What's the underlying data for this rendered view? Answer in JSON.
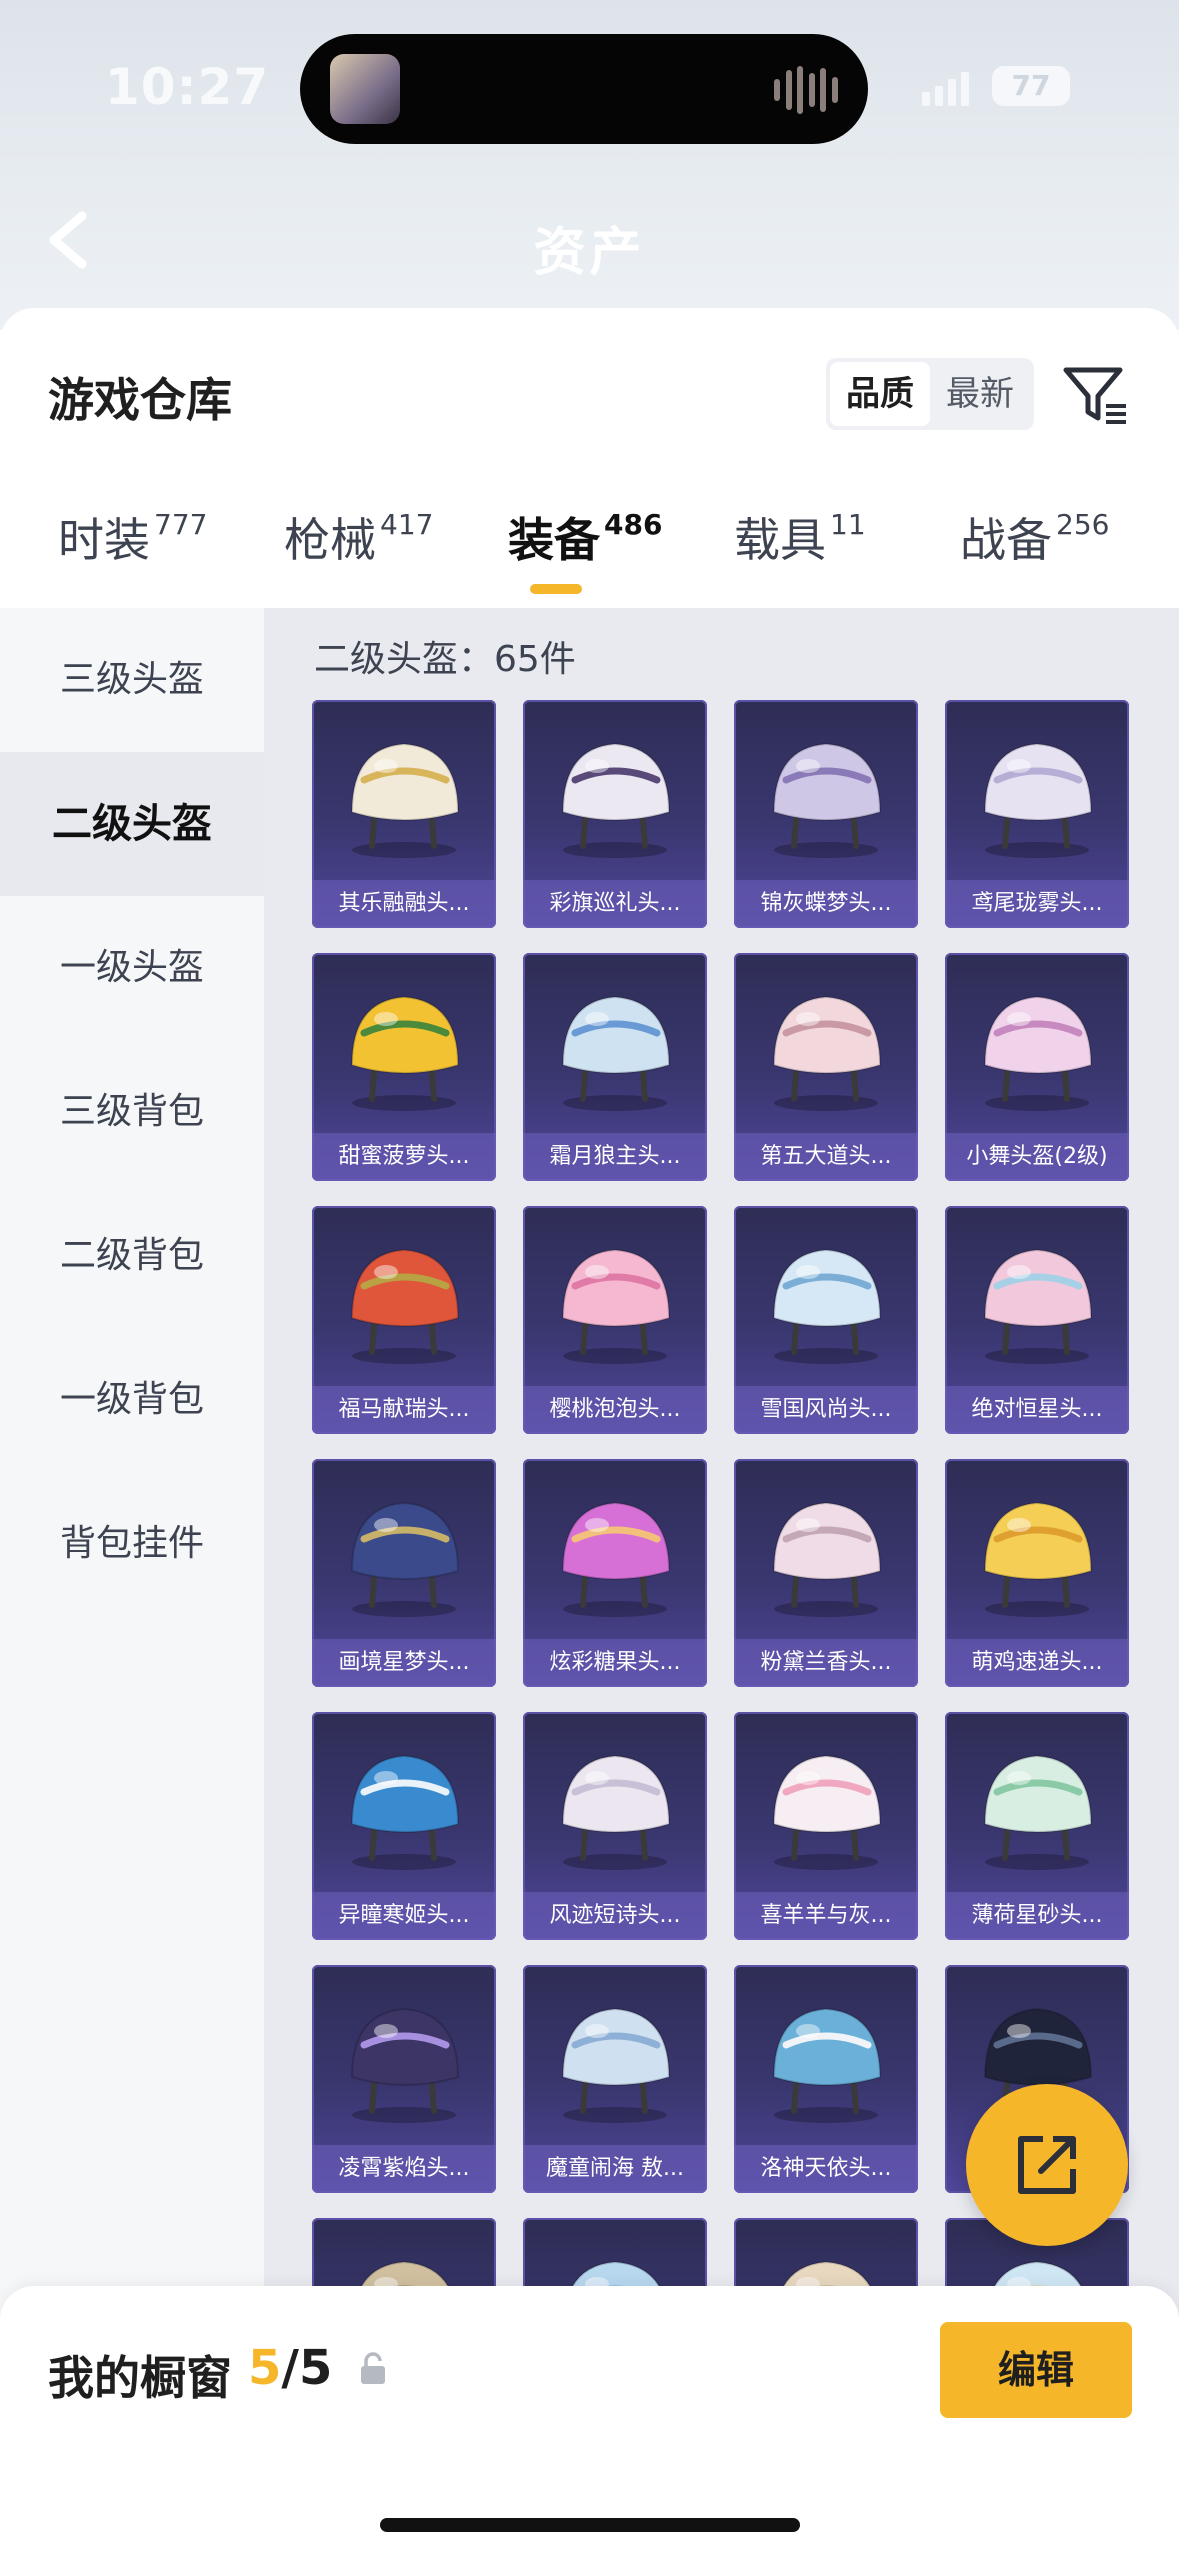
{
  "status_bar": {
    "time": "10:27",
    "battery": "77"
  },
  "header": {
    "title": "资产"
  },
  "page": {
    "title": "游戏仓库"
  },
  "sort": {
    "options": [
      "品质",
      "最新"
    ],
    "active": "品质"
  },
  "tabs": [
    {
      "label": "时装",
      "count": "777"
    },
    {
      "label": "枪械",
      "count": "417"
    },
    {
      "label": "装备",
      "count": "486",
      "active": true
    },
    {
      "label": "载具",
      "count": "11"
    },
    {
      "label": "战备",
      "count": "256"
    }
  ],
  "sidebar": {
    "items": [
      "三级头盔",
      "二级头盔",
      "一级头盔",
      "三级背包",
      "二级背包",
      "一级背包",
      "背包挂件"
    ],
    "active": "二级头盔"
  },
  "content": {
    "count_label": "二级头盔：65件",
    "items": [
      {
        "name": "其乐融融头...",
        "color": "#f2ead8",
        "accent": "#d8b45a"
      },
      {
        "name": "彩旗巡礼头...",
        "color": "#ece8f2",
        "accent": "#5a4a7a"
      },
      {
        "name": "锦灰蝶梦头...",
        "color": "#cfc7e6",
        "accent": "#8a7ab8"
      },
      {
        "name": "鸢尾珑雾头...",
        "color": "#e6e2f2",
        "accent": "#b7aed6"
      },
      {
        "name": "甜蜜菠萝头...",
        "color": "#f2c233",
        "accent": "#4a8a3a"
      },
      {
        "name": "霜月狼主头...",
        "color": "#cfe2f2",
        "accent": "#6a9ad6"
      },
      {
        "name": "第五大道头...",
        "color": "#f2d8dc",
        "accent": "#c99aa6"
      },
      {
        "name": "小舞头盔(2级)",
        "color": "#f0d2ea",
        "accent": "#c78ac0"
      },
      {
        "name": "福马献瑞头...",
        "color": "#e0563a",
        "accent": "#b8a244"
      },
      {
        "name": "樱桃泡泡头...",
        "color": "#f5b8d0",
        "accent": "#e07aa6"
      },
      {
        "name": "雪国风尚头...",
        "color": "#d6e8f5",
        "accent": "#7aaed6"
      },
      {
        "name": "绝对恒星头...",
        "color": "#f2c8dc",
        "accent": "#a6d0e6"
      },
      {
        "name": "画境星梦头...",
        "color": "#3a4a8a",
        "accent": "#c7b06a"
      },
      {
        "name": "炫彩糖果头...",
        "color": "#d670d6",
        "accent": "#f2c07a"
      },
      {
        "name": "粉黛兰香头...",
        "color": "#f0dce6",
        "accent": "#c4a8b8"
      },
      {
        "name": "萌鸡速递头...",
        "color": "#f5cf55",
        "accent": "#e0a030"
      },
      {
        "name": "异瞳寒姬头...",
        "color": "#3a8ad0",
        "accent": "#e9f2f8"
      },
      {
        "name": "风迹短诗头...",
        "color": "#ece6f0",
        "accent": "#c9bfd6"
      },
      {
        "name": "喜羊羊与灰...",
        "color": "#f6eef2",
        "accent": "#f0a8c0"
      },
      {
        "name": "薄荷星砂头...",
        "color": "#d8eee2",
        "accent": "#8acaa6"
      },
      {
        "name": "凌霄紫焰头...",
        "color": "#3c3566",
        "accent": "#a890e0"
      },
      {
        "name": "魔童闹海 敖...",
        "color": "#cfe0f0",
        "accent": "#8fb0d6"
      },
      {
        "name": "洛神天依头...",
        "color": "#6ab0d8",
        "accent": "#f0f4f8"
      },
      {
        "name": "",
        "color": "#20243a",
        "accent": "#5a6a8a"
      },
      {
        "name": "",
        "color": "#d0c0a0",
        "accent": "#8a7a6a"
      },
      {
        "name": "",
        "color": "#b8d8f0",
        "accent": "#7aa6cf"
      },
      {
        "name": "",
        "color": "#e8d8c0",
        "accent": "#b89a70"
      },
      {
        "name": "",
        "color": "#cfe6f5",
        "accent": "#f2c26a"
      }
    ]
  },
  "showcase": {
    "label": "我的橱窗",
    "current": "5",
    "separator": "/",
    "max": "5"
  },
  "edit_button": {
    "label": "编辑"
  },
  "icons": {
    "back": "chevron-left-icon",
    "filter": "filter-icon",
    "share": "share-external-icon",
    "lock": "lock-icon"
  }
}
